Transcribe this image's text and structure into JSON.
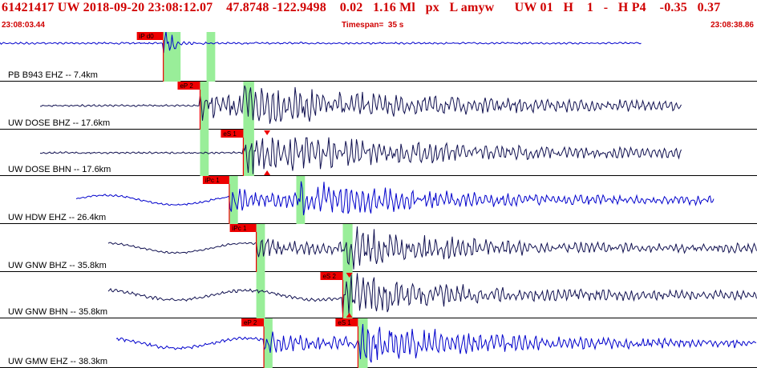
{
  "header": {
    "title": "61421417 UW 2018-09-20 23:08:12.07    47.8748 -122.9498    0.02   1.16 Ml   px   L amyw      UW 01   H    1   -   H P4    -0.35   0.37",
    "start_time": "23:08:03.44",
    "timespan": "Timespan=  35 s",
    "end_time": "23:08:38.86"
  },
  "colors": {
    "header_text": "#d00000",
    "trace_blue": "#0000cc",
    "trace_navy": "#101050",
    "pick_red": "#ee0000",
    "window_green": "#99ee99"
  },
  "traces": [
    {
      "label": "PB B943 EHZ -- 7.4km",
      "color": "blue",
      "amp": "pulse",
      "picks": [
        {
          "label": "iP d0",
          "t": 7.55
        }
      ],
      "windows": [
        [
          7.55,
          8.35
        ],
        [
          9.55,
          9.95
        ]
      ],
      "marks": []
    },
    {
      "label": "UW DOSE BHZ -- 17.6km",
      "color": "navy",
      "amp": "steady",
      "picks": [
        {
          "label": "eP 2",
          "t": 9.25
        }
      ],
      "windows": [
        [
          9.25,
          9.65
        ],
        [
          11.25,
          11.75
        ]
      ],
      "marks": []
    },
    {
      "label": "UW DOSE BHN -- 17.6km",
      "color": "navy",
      "amp": "steady",
      "picks": [
        {
          "label": "eS 1",
          "t": 11.25
        }
      ],
      "windows": [
        [
          9.25,
          9.65
        ],
        [
          11.25,
          11.75
        ]
      ],
      "marks": [
        12.35
      ]
    },
    {
      "label": "UW HDW EHZ -- 26.4km",
      "color": "blue",
      "amp": "twoBurst",
      "picks": [
        {
          "label": "iPc 1",
          "t": 10.6
        }
      ],
      "windows": [
        [
          10.6,
          11.0
        ],
        [
          13.7,
          14.1
        ]
      ],
      "marks": []
    },
    {
      "label": "UW GNW BHZ -- 35.8km",
      "color": "navy",
      "amp": "twoBurst",
      "picks": [
        {
          "label": "iPc 1",
          "t": 11.85
        }
      ],
      "windows": [
        [
          11.85,
          12.25
        ],
        [
          15.85,
          16.3
        ]
      ],
      "marks": []
    },
    {
      "label": "UW GNW BHN -- 35.8km",
      "color": "navy",
      "amp": "lateBurst",
      "picks": [
        {
          "label": "eS 2",
          "t": 15.85
        }
      ],
      "windows": [
        [
          11.85,
          12.25
        ],
        [
          15.85,
          16.3
        ]
      ],
      "marks": [
        16.15
      ]
    },
    {
      "label": "UW GMW EHZ -- 38.3km",
      "color": "blue",
      "amp": "lateBurst",
      "picks": [
        {
          "label": "eP 2",
          "t": 12.2
        },
        {
          "label": "eS 1",
          "t": 16.55
        }
      ],
      "windows": [
        [
          12.2,
          12.6
        ],
        [
          16.55,
          17.0
        ]
      ],
      "marks": []
    }
  ]
}
